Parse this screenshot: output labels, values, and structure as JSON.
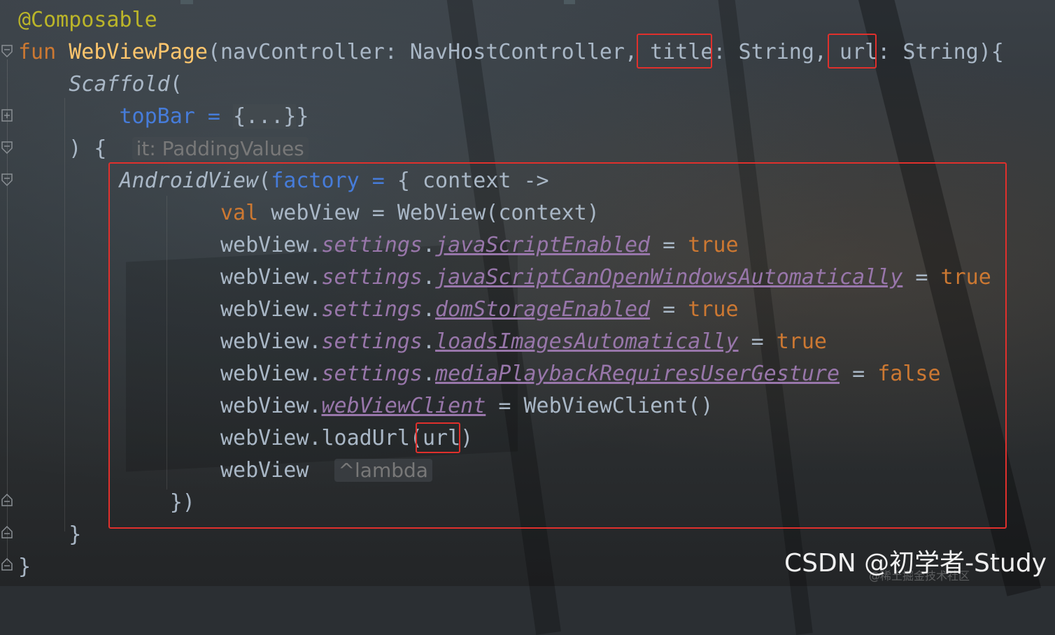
{
  "editor": {
    "lines": [
      {
        "parts": [
          {
            "t": "@Composable",
            "c": "ann"
          }
        ]
      },
      {
        "parts": [
          {
            "t": "fun ",
            "c": "kw"
          },
          {
            "t": "WebViewPage",
            "c": "fn"
          },
          {
            "t": "(navController: NavHostController, "
          },
          {
            "t": "title"
          },
          {
            "t": ": String, "
          },
          {
            "t": "url"
          },
          {
            "t": ": String){"
          }
        ]
      },
      {
        "parts": [
          {
            "t": "    "
          },
          {
            "t": "Scaffold",
            "c": "it"
          },
          {
            "t": "("
          }
        ]
      },
      {
        "parts": [
          {
            "t": "        "
          },
          {
            "t": "topBar",
            "c": "param"
          },
          {
            "t": " = ",
            "c": "param"
          },
          {
            "t": "{...}",
            "c": "fold-txt"
          },
          {
            "t": "}"
          }
        ]
      },
      {
        "parts": [
          {
            "t": "    ) {  "
          },
          {
            "t": "it: PaddingValues",
            "c": "hint"
          }
        ]
      },
      {
        "parts": [
          {
            "t": "        "
          },
          {
            "t": "AndroidView",
            "c": "it"
          },
          {
            "t": "("
          },
          {
            "t": "factory",
            "c": "param"
          },
          {
            "t": " = ",
            "c": "param"
          },
          {
            "t": "{ context ->"
          }
        ]
      },
      {
        "parts": [
          {
            "t": "                "
          },
          {
            "t": "val ",
            "c": "kw"
          },
          {
            "t": "webView = WebView(context)"
          }
        ]
      },
      {
        "parts": [
          {
            "t": "                webView."
          },
          {
            "t": "settings",
            "c": "prop"
          },
          {
            "t": "."
          },
          {
            "t": "javaScriptEnabled",
            "c": "prop-u"
          },
          {
            "t": " = "
          },
          {
            "t": "true",
            "c": "kw"
          }
        ]
      },
      {
        "parts": [
          {
            "t": "                webView."
          },
          {
            "t": "settings",
            "c": "prop"
          },
          {
            "t": "."
          },
          {
            "t": "javaScriptCanOpenWindowsAutomatically",
            "c": "prop-u"
          },
          {
            "t": " = "
          },
          {
            "t": "true",
            "c": "kw"
          }
        ]
      },
      {
        "parts": [
          {
            "t": "                webView."
          },
          {
            "t": "settings",
            "c": "prop"
          },
          {
            "t": "."
          },
          {
            "t": "domStorageEnabled",
            "c": "prop-u"
          },
          {
            "t": " = "
          },
          {
            "t": "true",
            "c": "kw"
          }
        ]
      },
      {
        "parts": [
          {
            "t": "                webView."
          },
          {
            "t": "settings",
            "c": "prop"
          },
          {
            "t": "."
          },
          {
            "t": "loadsImagesAutomatically",
            "c": "prop-u"
          },
          {
            "t": " = "
          },
          {
            "t": "true",
            "c": "kw"
          }
        ]
      },
      {
        "parts": [
          {
            "t": "                webView."
          },
          {
            "t": "settings",
            "c": "prop"
          },
          {
            "t": "."
          },
          {
            "t": "mediaPlaybackRequiresUserGesture",
            "c": "prop-u"
          },
          {
            "t": " = "
          },
          {
            "t": "false",
            "c": "kw"
          }
        ]
      },
      {
        "parts": [
          {
            "t": "                webView."
          },
          {
            "t": "webViewClient",
            "c": "prop-u"
          },
          {
            "t": " = WebViewClient()"
          }
        ]
      },
      {
        "parts": [
          {
            "t": "                webView.loadUrl("
          },
          {
            "t": "url"
          },
          {
            "t": ")"
          }
        ]
      },
      {
        "parts": [
          {
            "t": "                webView  "
          },
          {
            "t": "^lambda",
            "c": "hint"
          }
        ]
      },
      {
        "parts": [
          {
            "t": "            })"
          }
        ]
      },
      {
        "parts": [
          {
            "t": "    }"
          }
        ]
      },
      {
        "parts": [
          {
            "t": "}"
          }
        ]
      }
    ]
  },
  "watermark": {
    "text": "CSDN @初学者-Study",
    "subtext": "@稀土掘金技术社区"
  }
}
